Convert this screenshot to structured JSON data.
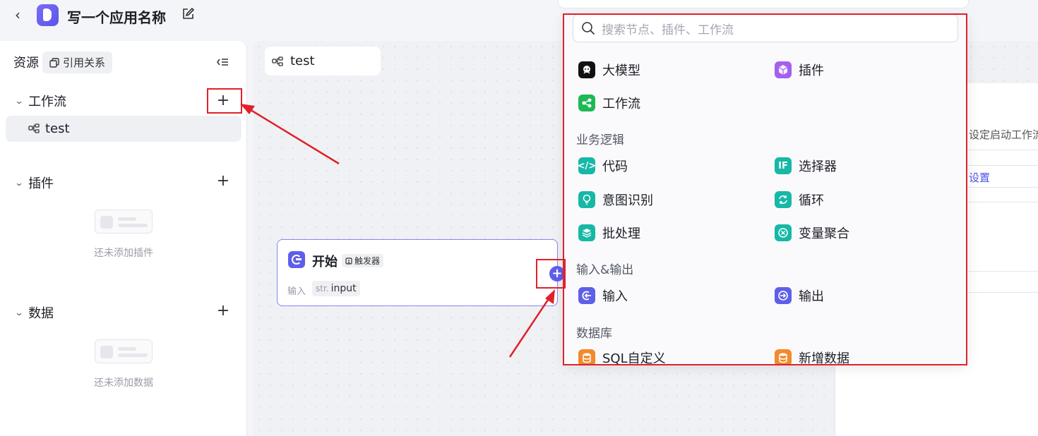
{
  "header": {
    "back_icon": "chevron-left-icon",
    "app_title": "写一个应用名称",
    "edit_icon": "edit-icon"
  },
  "sidebar": {
    "title": "资源",
    "ref_button": "引用关系",
    "sections": {
      "workflow": {
        "label": "工作流",
        "items": [
          "test"
        ]
      },
      "plugin": {
        "label": "插件",
        "empty_text": "还未添加插件"
      },
      "data": {
        "label": "数据",
        "empty_text": "还未添加数据"
      }
    },
    "add_label": "+"
  },
  "canvas": {
    "tab_label": "test",
    "start_node": {
      "title": "开始",
      "trigger_label": "触发器",
      "input_label": "输入",
      "input_type": "str.",
      "input_name": "input"
    }
  },
  "right_panel": {
    "hint_text": "设定启动工作流",
    "link_text": "设置"
  },
  "picker": {
    "search_placeholder": "搜索节点、插件、工作流",
    "top_items": [
      "大模型",
      "插件",
      "工作流"
    ],
    "categories": {
      "logic": {
        "label": "业务逻辑",
        "items": [
          "代码",
          "选择器",
          "意图识别",
          "循环",
          "批处理",
          "变量聚合"
        ]
      },
      "io": {
        "label": "输入&输出",
        "items": [
          "输入",
          "输出"
        ]
      },
      "db": {
        "label": "数据库",
        "items": [
          "SQL自定义",
          "新增数据"
        ]
      }
    }
  },
  "colors": {
    "accent": "#5e5fe9",
    "highlight_box": "#e0212a",
    "teal": "#16b8a6",
    "green": "#1db954",
    "purple": "#a55ff0",
    "orange": "#f28a2b"
  }
}
